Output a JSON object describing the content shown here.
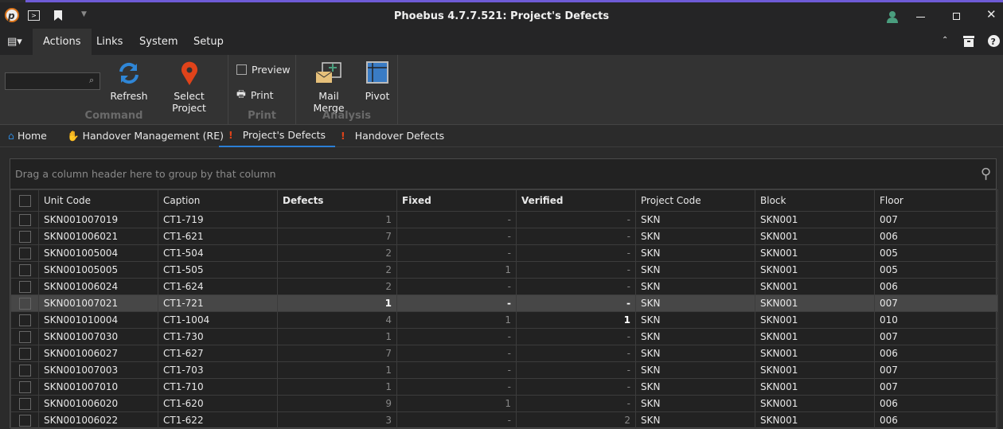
{
  "window": {
    "title": "Phoebus 4.7.7.521: Project's Defects",
    "accent": "#6e5bd6"
  },
  "menu": {
    "tabs": [
      "Actions",
      "Links",
      "System",
      "Setup"
    ]
  },
  "ribbon": {
    "search_value": "",
    "command": {
      "label": "Command",
      "refresh": "Refresh",
      "select_project": "Select Project"
    },
    "print": {
      "label": "Print",
      "preview": "Preview",
      "print": "Print"
    },
    "analysis": {
      "label": "Analysis",
      "mail_merge": "Mail Merge",
      "pivot": "Pivot"
    }
  },
  "doc_tabs": [
    "Home",
    "Handover Management (RE)",
    "Project's Defects",
    "Handover Defects"
  ],
  "grid": {
    "group_hint": "Drag a column header here to group by that column",
    "columns": [
      "Unit Code",
      "Caption",
      "Defects",
      "Fixed",
      "Verified",
      "Project Code",
      "Block",
      "Floor"
    ],
    "rows": [
      [
        "SKN001007019",
        "CT1-719",
        "1",
        "-",
        "-",
        "SKN",
        "SKN001",
        "007"
      ],
      [
        "SKN001006021",
        "CT1-621",
        "7",
        "-",
        "-",
        "SKN",
        "SKN001",
        "006"
      ],
      [
        "SKN001005004",
        "CT1-504",
        "2",
        "-",
        "-",
        "SKN",
        "SKN001",
        "005"
      ],
      [
        "SKN001005005",
        "CT1-505",
        "2",
        "1",
        "-",
        "SKN",
        "SKN001",
        "005"
      ],
      [
        "SKN001006024",
        "CT1-624",
        "2",
        "-",
        "-",
        "SKN",
        "SKN001",
        "006"
      ],
      [
        "SKN001007021",
        "CT1-721",
        "1",
        "-",
        "-",
        "SKN",
        "SKN001",
        "007"
      ],
      [
        "SKN001010004",
        "CT1-1004",
        "4",
        "1",
        "1",
        "SKN",
        "SKN001",
        "010"
      ],
      [
        "SKN001007030",
        "CT1-730",
        "1",
        "-",
        "-",
        "SKN",
        "SKN001",
        "007"
      ],
      [
        "SKN001006027",
        "CT1-627",
        "7",
        "-",
        "-",
        "SKN",
        "SKN001",
        "006"
      ],
      [
        "SKN001007003",
        "CT1-703",
        "1",
        "-",
        "-",
        "SKN",
        "SKN001",
        "007"
      ],
      [
        "SKN001007010",
        "CT1-710",
        "1",
        "-",
        "-",
        "SKN",
        "SKN001",
        "007"
      ],
      [
        "SKN001006020",
        "CT1-620",
        "9",
        "1",
        "-",
        "SKN",
        "SKN001",
        "006"
      ],
      [
        "SKN001006022",
        "CT1-622",
        "3",
        "-",
        "2",
        "SKN",
        "SKN001",
        "006"
      ]
    ],
    "selected_row": 5
  }
}
